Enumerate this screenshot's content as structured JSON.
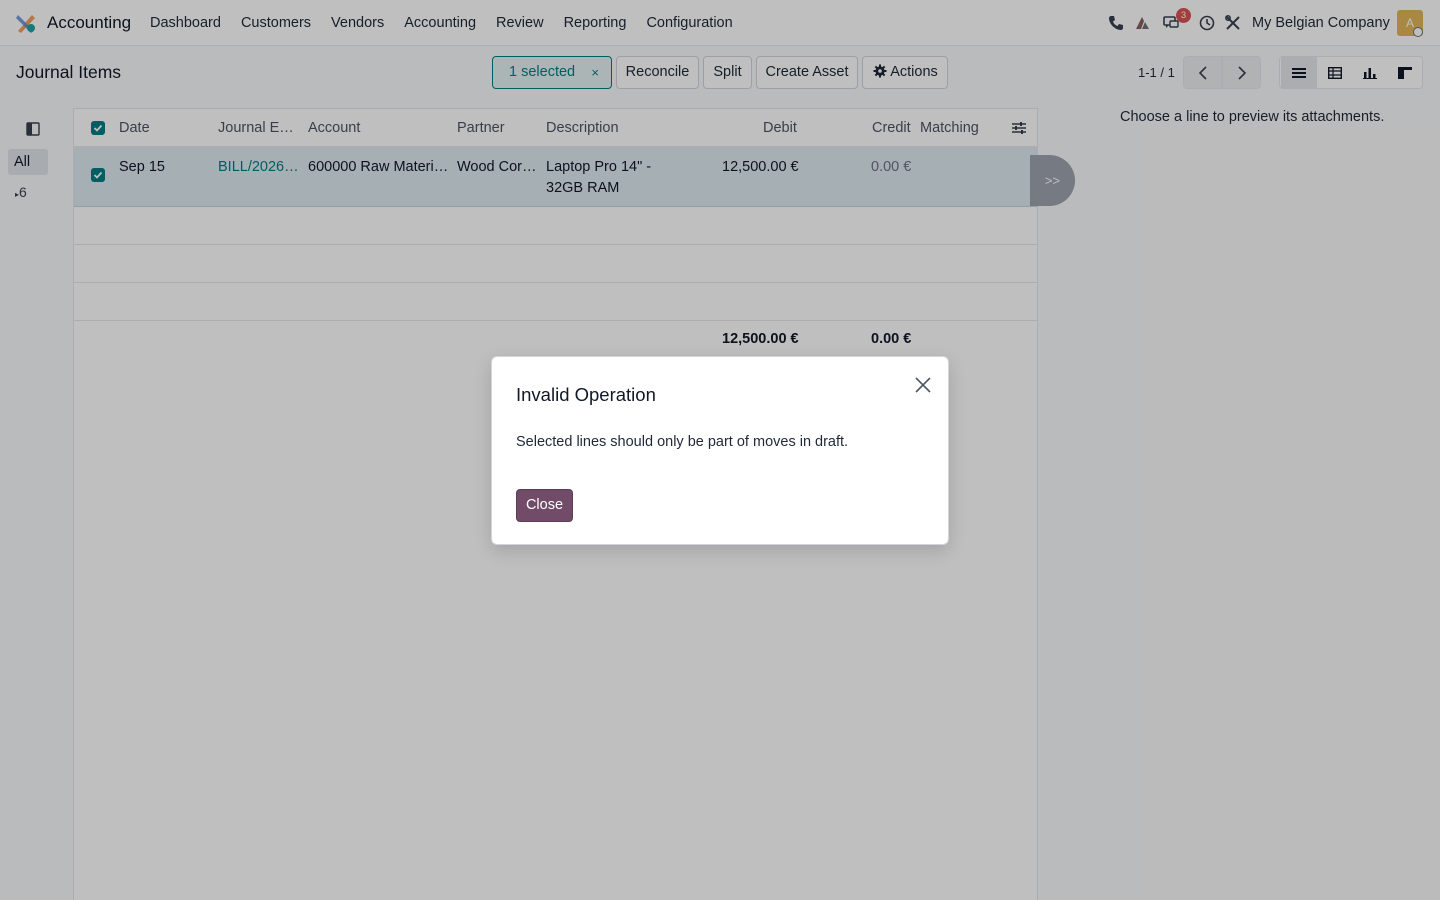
{
  "navbar": {
    "app_name": "Accounting",
    "menu": [
      "Dashboard",
      "Customers",
      "Vendors",
      "Accounting",
      "Review",
      "Reporting",
      "Configuration"
    ],
    "notification_count": "3",
    "company": "My Belgian Company",
    "avatar_letter": "A"
  },
  "control_panel": {
    "breadcrumb": "Journal Items",
    "selected_label": "1 selected",
    "clear_selection": "×",
    "buttons": {
      "reconcile": "Reconcile",
      "split": "Split",
      "create_asset": "Create Asset",
      "actions": "Actions"
    },
    "pager": "1-1 / 1"
  },
  "search_panel": {
    "all": "All",
    "group": "6"
  },
  "list": {
    "columns": [
      "Date",
      "Journal E…",
      "Account",
      "Partner",
      "Description",
      "Debit",
      "Credit",
      "Matching"
    ],
    "rows": [
      {
        "date": "Sep 15",
        "journal_entry": "BILL/2026…",
        "account": "600000 Raw Materi…",
        "partner": "Wood Cor…",
        "description_line1": "Laptop Pro 14\" -",
        "description_line2": "32GB RAM",
        "debit": "12,500.00 €",
        "credit": "0.00 €",
        "matching": ""
      }
    ],
    "totals": {
      "debit": "12,500.00 €",
      "credit": "0.00 €"
    }
  },
  "preview": {
    "toggle": ">>",
    "message": "Choose a line to preview its attachments."
  },
  "modal": {
    "title": "Invalid Operation",
    "body": "Selected lines should only be part of moves in draft.",
    "close_button": "Close"
  },
  "colors": {
    "primary": "#714b67",
    "accent": "#017e84",
    "badge": "#d9534f"
  }
}
